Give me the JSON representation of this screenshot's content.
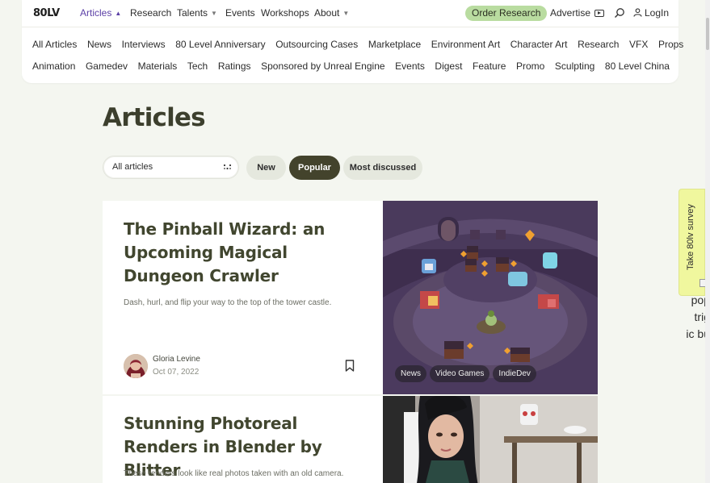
{
  "header": {
    "logo": "80LV",
    "nav": [
      {
        "label": "Articles",
        "dropdown": true,
        "active": true
      },
      {
        "label": "Research",
        "dropdown": false
      },
      {
        "label": "Talents",
        "dropdown": true
      },
      {
        "label": "Events",
        "dropdown": false
      },
      {
        "label": "Workshops",
        "dropdown": false
      },
      {
        "label": "About",
        "dropdown": true
      }
    ],
    "order_research": "Order Research",
    "advertise": "Advertise",
    "login": "LogIn",
    "accent_color": "#5b3fa6",
    "order_color": "#b9dca0"
  },
  "categories": {
    "row1": [
      "All Articles",
      "News",
      "Interviews",
      "80 Level Anniversary",
      "Outsourcing Cases",
      "Marketplace",
      "Environment Art",
      "Character Art",
      "Research",
      "VFX",
      "Props"
    ],
    "row2": [
      "Animation",
      "Gamedev",
      "Materials",
      "Tech",
      "Ratings",
      "Sponsored by Unreal Engine",
      "Events",
      "Digest",
      "Feature",
      "Promo",
      "Sculpting",
      "80 Level China"
    ]
  },
  "page": {
    "title": "Articles"
  },
  "filters": {
    "select_value": "All articles",
    "pills": {
      "new": "New",
      "popular": "Popular",
      "most_discussed": "Most discussed"
    },
    "active": "Popular"
  },
  "articles": [
    {
      "title": "The Pinball Wizard: an Upcoming Magical Dungeon Crawler",
      "description": "Dash, hurl, and flip your way to the top of the tower castle.",
      "author": "Gloria Levine",
      "date": "Oct 07, 2022",
      "tags": [
        "News",
        "Video Games",
        "IndieDev"
      ]
    },
    {
      "title": "Stunning Photoreal Renders in Blender by Blitter",
      "description": "These renders look like real photos taken with an old camera."
    }
  ],
  "survey": {
    "label": "Take 80lv survey",
    "broken_image_text": "pop trig ic bu"
  }
}
